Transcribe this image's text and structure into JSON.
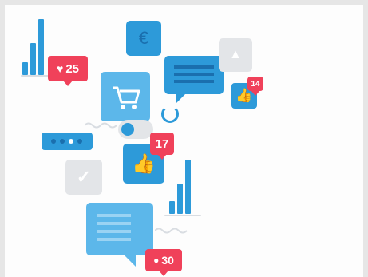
{
  "badges": {
    "likes": "25",
    "thumbs": "17",
    "small_thumbs": "14",
    "comments": "30"
  },
  "icons": {
    "currency": "€"
  },
  "colors": {
    "blue": "#2d9ad9",
    "light_blue": "#5cb7ea",
    "red": "#f0415a",
    "gray": "#d9dde2"
  }
}
